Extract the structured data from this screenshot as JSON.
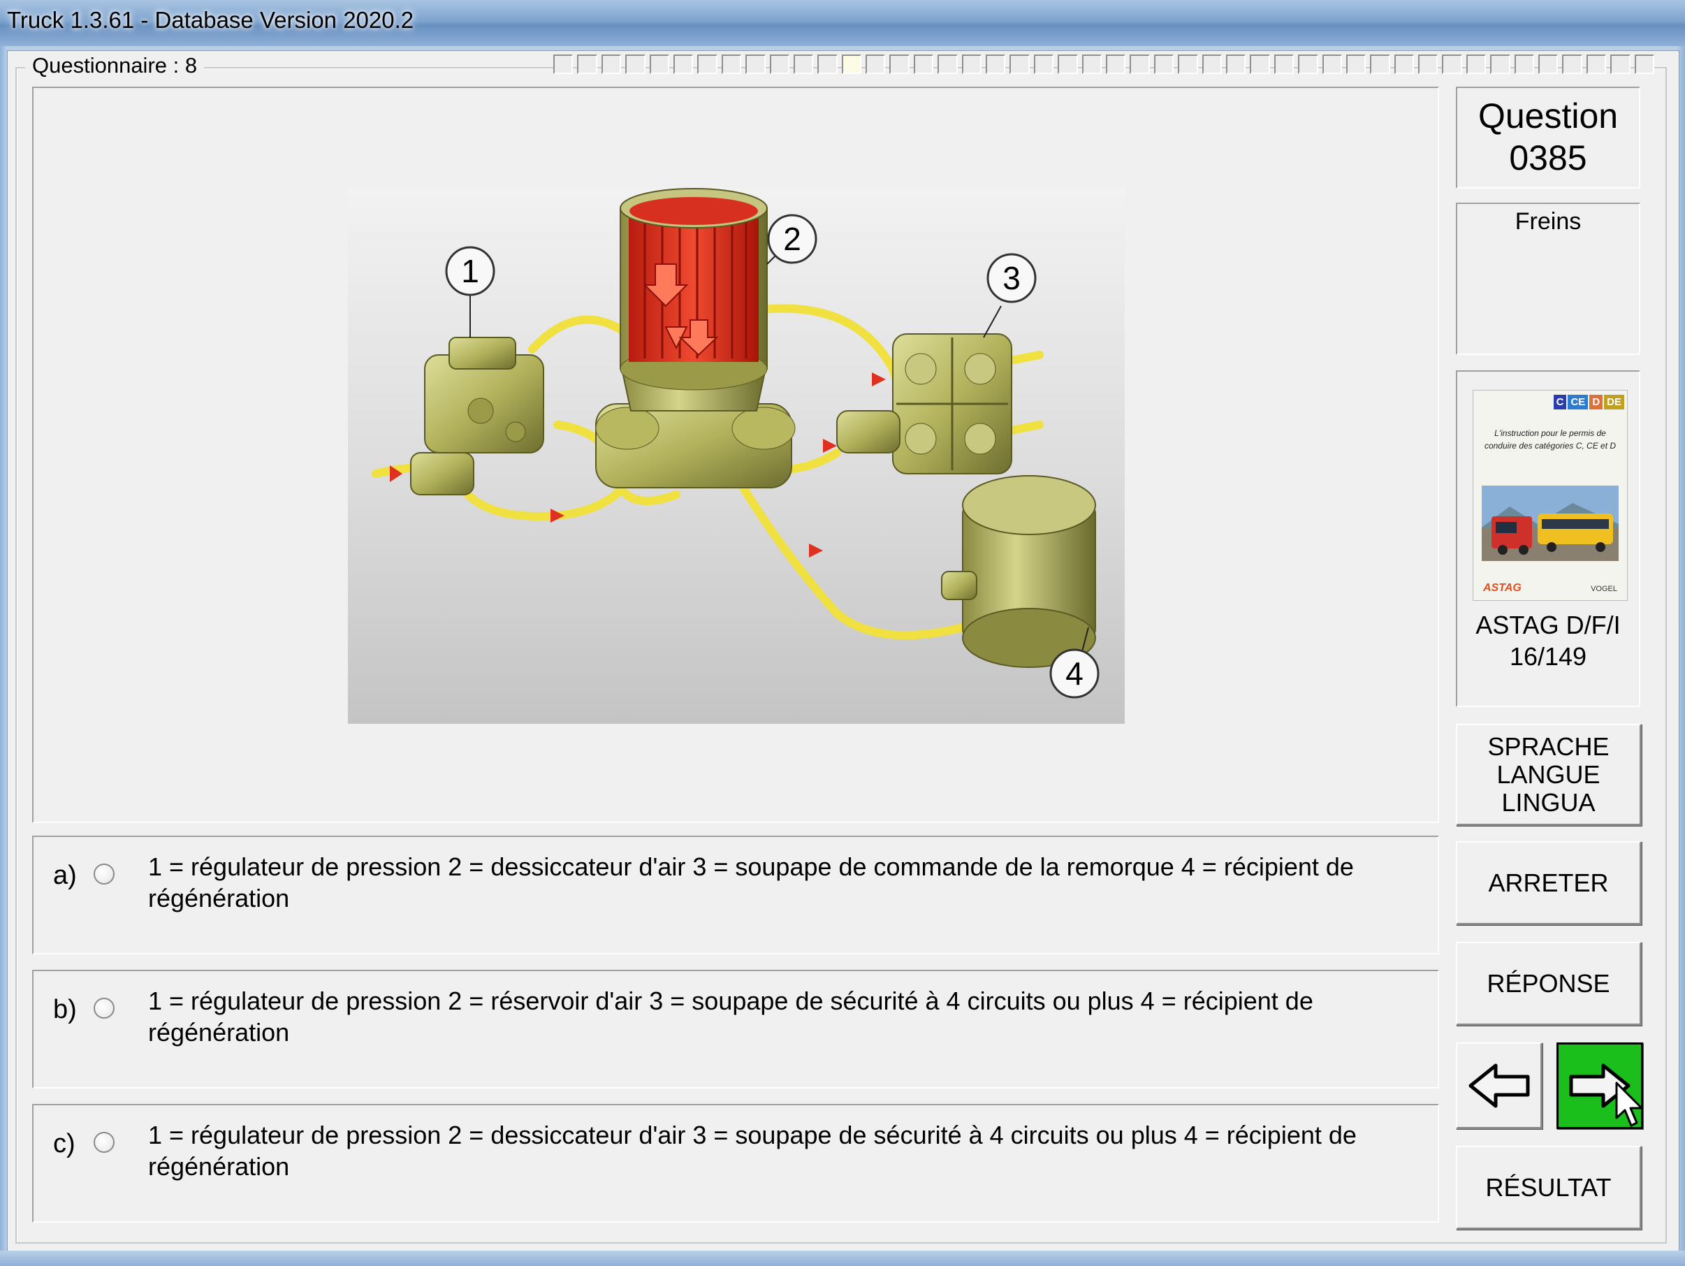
{
  "window": {
    "title": "Truck 1.3.61 - Database Version 2020.2"
  },
  "questionnaire": {
    "label": "Questionnaire : 8",
    "progress_segments": 46,
    "progress_current_segment": 12
  },
  "diagram": {
    "callouts": [
      "1",
      "2",
      "3",
      "4"
    ]
  },
  "answers": [
    {
      "letter": "a)",
      "text": "1 = régulateur de pression  2 = dessiccateur d'air  3 = soupape de commande de la remorque  4 = récipient de régénération"
    },
    {
      "letter": "b)",
      "text": "1 = régulateur de pression  2 = réservoir d'air  3 = soupape de sécurité à 4 circuits ou plus 4 = récipient de régénération"
    },
    {
      "letter": "c)",
      "text": "1 = régulateur de pression  2 = dessiccateur d'air  3 = soupape de sécurité à 4 circuits ou plus  4 = récipient de régénération"
    }
  ],
  "sidebar": {
    "question_label": "Question",
    "question_number": "0385",
    "category": "Freins",
    "book": {
      "tags": [
        "C",
        "CE",
        "D",
        "DE"
      ],
      "tag_colors": [
        "#2a3cb0",
        "#2b7bd0",
        "#e0703a",
        "#c0a020"
      ],
      "cover_text": "L'instruction pour le permis de conduire des catégories C, CE et D",
      "publisher": "ASTAG",
      "publisher2": "VOGEL",
      "caption_line1": "ASTAG D/F/I",
      "caption_line2": "16/149"
    }
  },
  "buttons": {
    "language": [
      "SPRACHE",
      "LANGUE",
      "LINGUA"
    ],
    "stop": "ARRETER",
    "answer": "RÉPONSE",
    "prev_icon": "arrow-left-icon",
    "next_icon": "arrow-right-icon",
    "result": "RÉSULTAT"
  },
  "colors": {
    "next_button": "#1bbf1b",
    "dryer_red": "#e03020",
    "pipe_yellow": "#f0e040",
    "component_olive": "#b8b860"
  }
}
